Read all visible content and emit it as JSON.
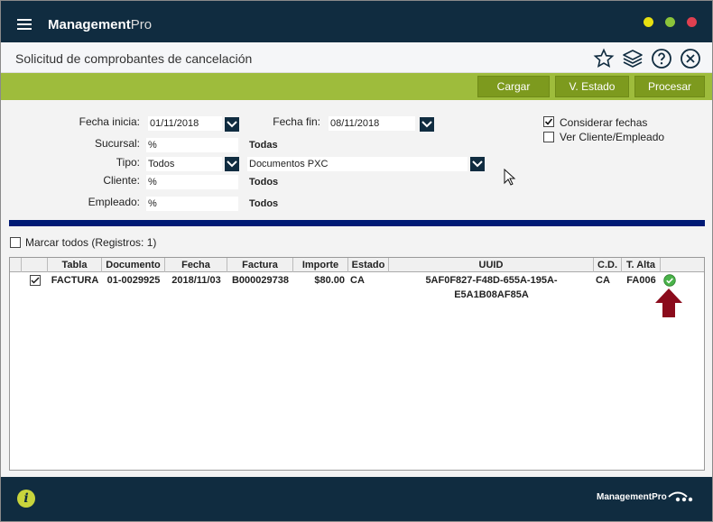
{
  "app": {
    "brand_bold": "Management",
    "brand_light": "Pro",
    "footer_brand": "ManagementPro"
  },
  "window_controls": {
    "colors": [
      "#e7e010",
      "#8bc43a",
      "#e04050"
    ]
  },
  "page": {
    "title": "Solicitud de comprobantes de cancelación"
  },
  "toolbar_icons": [
    "star-icon",
    "layers-icon",
    "help-icon",
    "close-icon"
  ],
  "actions": {
    "cargar": "Cargar",
    "vestado": "V. Estado",
    "procesar": "Procesar"
  },
  "form": {
    "fecha_inicia_label": "Fecha inicia:",
    "fecha_inicia": "01/11/2018",
    "fecha_fin_label": "Fecha fin:",
    "fecha_fin": "08/11/2018",
    "sucursal_label": "Sucursal:",
    "sucursal": "%",
    "sucursal_desc": "Todas",
    "tipo_label": "Tipo:",
    "tipo": "Todos",
    "tipo_doc": "Documentos PXC",
    "cliente_label": "Cliente:",
    "cliente": "%",
    "cliente_desc": "Todos",
    "empleado_label": "Empleado:",
    "empleado": "%",
    "empleado_desc": "Todos",
    "considerar_fechas": "Considerar fechas",
    "considerar_checked": true,
    "ver_cliente": "Ver Cliente/Empleado",
    "ver_checked": false
  },
  "marcar_todos": "Marcar todos (Registros: 1)",
  "grid": {
    "headers": [
      "",
      "Tabla",
      "Documento",
      "Fecha",
      "Factura",
      "Importe",
      "Estado",
      "UUID",
      "C.D.",
      "T. Alta",
      ""
    ],
    "rows": [
      {
        "tabla": "FACTURA",
        "documento": "01-0029925",
        "fecha": "2018/11/03",
        "factura": "B000029738",
        "importe": "$80.00",
        "estado": "CA",
        "uuid": "5AF0F827-F48D-655A-195A-E5A1B08AF85A",
        "cd": "CA",
        "talta": "FA006",
        "status_icon": "check-circle-icon"
      }
    ]
  },
  "colors": {
    "navy": "#102c40",
    "green": "#9ebc3c",
    "button_green": "#7d9a1e",
    "blue_bar": "#001a75",
    "arrow": "#8b0b1c"
  }
}
